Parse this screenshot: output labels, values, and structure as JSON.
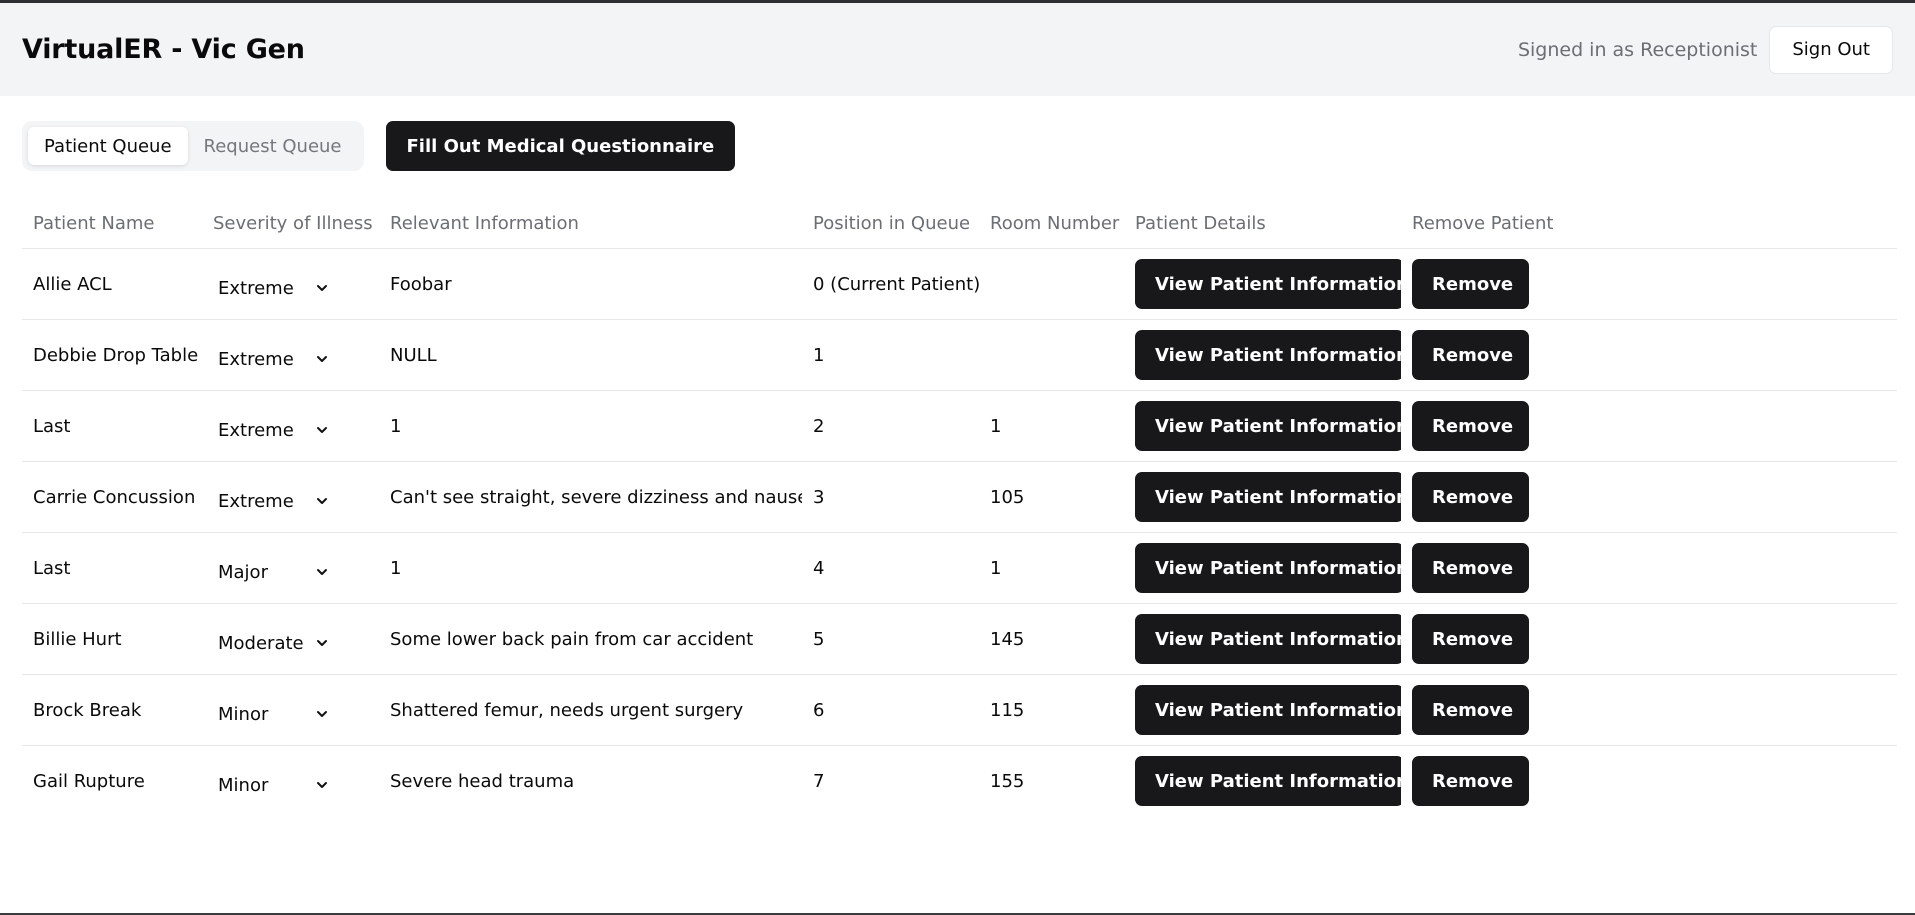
{
  "header": {
    "title": "VirtualER - Vic Gen",
    "signed_in_text": "Signed in as Receptionist",
    "sign_out_label": "Sign Out"
  },
  "toolbar": {
    "tabs": [
      {
        "label": "Patient Queue",
        "active": true
      },
      {
        "label": "Request Queue",
        "active": false
      }
    ],
    "questionnaire_label": "Fill Out Medical Questionnaire"
  },
  "table": {
    "columns": [
      "Patient Name",
      "Severity of Illness",
      "Relevant Information",
      "Position in Queue",
      "Room Number",
      "Patient Details",
      "Remove Patient"
    ],
    "view_label": "View Patient Information",
    "remove_label": "Remove",
    "rows": [
      {
        "name": "Allie ACL",
        "severity": "Extreme",
        "info": "Foobar",
        "position": "0 (Current Patient)",
        "room": ""
      },
      {
        "name": "Debbie Drop Table",
        "severity": "Extreme",
        "info": "NULL",
        "position": "1",
        "room": ""
      },
      {
        "name": "Last",
        "severity": "Extreme",
        "info": "1",
        "position": "2",
        "room": "1"
      },
      {
        "name": "Carrie Concussion",
        "severity": "Extreme",
        "info": "Can't see straight, severe dizziness and nausea",
        "position": "3",
        "room": "105"
      },
      {
        "name": "Last",
        "severity": "Major",
        "info": "1",
        "position": "4",
        "room": "1"
      },
      {
        "name": "Billie Hurt",
        "severity": "Moderate",
        "info": "Some lower back pain from car accident",
        "position": "5",
        "room": "145"
      },
      {
        "name": "Brock Break",
        "severity": "Minor",
        "info": "Shattered femur, needs urgent surgery",
        "position": "6",
        "room": "115"
      },
      {
        "name": "Gail Rupture",
        "severity": "Minor",
        "info": "Severe head trauma",
        "position": "7",
        "room": "155"
      }
    ]
  },
  "colors": {
    "button_dark": "#18181b",
    "header_bg": "#f3f4f6",
    "muted_text": "#6b6e73"
  },
  "icons": {
    "select_arrow": "chevron-down-icon"
  }
}
